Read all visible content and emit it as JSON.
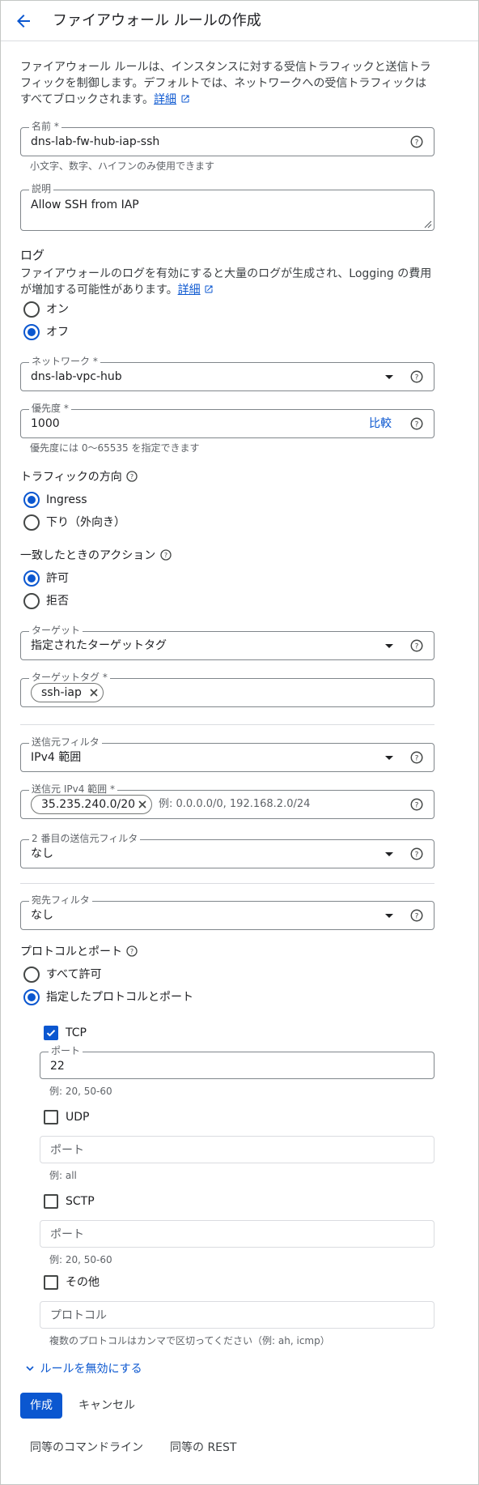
{
  "header": {
    "title": "ファイアウォール ルールの作成"
  },
  "intro": {
    "line1": "ファイアウォール ルールは、インスタンスに対する受信トラフィックと送信トラ",
    "line2": "フィックを制御します。デフォルトでは、ネットワークへの受信トラフィックは",
    "line3": "すべてブロックされます。",
    "link": "詳細"
  },
  "name_field": {
    "label": "名前 *",
    "value": "dns-lab-fw-hub-iap-ssh",
    "hint": "小文字、数字、ハイフンのみ使用できます"
  },
  "description_field": {
    "label": "説明",
    "value": "Allow SSH from IAP"
  },
  "logs": {
    "title": "ログ",
    "line1": "ファイアウォールのログを有効にすると大量のログが生成され、Logging の費用",
    "line2": "が増加する可能性があります。",
    "link": "詳細",
    "options": [
      {
        "label": "オン",
        "selected": false
      },
      {
        "label": "オフ",
        "selected": true
      }
    ]
  },
  "network_field": {
    "label": "ネットワーク *",
    "value": "dns-lab-vpc-hub"
  },
  "priority_field": {
    "label": "優先度 *",
    "value": "1000",
    "compare": "比較",
    "hint": "優先度には 0〜65535 を指定できます"
  },
  "direction": {
    "title": "トラフィックの方向",
    "options": [
      {
        "label": "Ingress",
        "selected": true
      },
      {
        "label": "下り（外向き）",
        "selected": false
      }
    ]
  },
  "action": {
    "title": "一致したときのアクション",
    "options": [
      {
        "label": "許可",
        "selected": true
      },
      {
        "label": "拒否",
        "selected": false
      }
    ]
  },
  "target_field": {
    "label": "ターゲット",
    "value": "指定されたターゲットタグ"
  },
  "target_tags_field": {
    "label": "ターゲットタグ *",
    "chip": "ssh-iap"
  },
  "source_filter_field": {
    "label": "送信元フィルタ",
    "value": "IPv4 範囲"
  },
  "source_ranges_field": {
    "label": "送信元 IPv4 範囲 *",
    "chip": "35.235.240.0/20",
    "placeholder": "例: 0.0.0.0/0, 192.168.2.0/24"
  },
  "second_source_filter_field": {
    "label": "2 番目の送信元フィルタ",
    "value": "なし"
  },
  "dest_filter_field": {
    "label": "宛先フィルタ",
    "value": "なし"
  },
  "protocols": {
    "title": "プロトコルとポート",
    "options": [
      {
        "label": "すべて許可",
        "selected": false
      },
      {
        "label": "指定したプロトコルとポート",
        "selected": true
      }
    ],
    "tcp": {
      "label": "TCP",
      "checked": true,
      "port_label": "ポート",
      "port_value": "22",
      "hint": "例: 20, 50-60"
    },
    "udp": {
      "label": "UDP",
      "checked": false,
      "placeholder": "ポート",
      "hint": "例: all"
    },
    "sctp": {
      "label": "SCTP",
      "checked": false,
      "placeholder": "ポート",
      "hint": "例: 20, 50-60"
    },
    "other": {
      "label": "その他",
      "checked": false,
      "placeholder": "プロトコル",
      "hint": "複数のプロトコルはカンマで区切ってください（例: ah, icmp）"
    }
  },
  "disable_rule": "ルールを無効にする",
  "buttons": {
    "create": "作成",
    "cancel": "キャンセル"
  },
  "footer": {
    "command_line": "同等のコマンドライン",
    "rest": "同等の REST"
  },
  "colors": {
    "accent": "#0b57d0",
    "text": "#202124",
    "muted": "#5f6368",
    "border": "#80868b"
  }
}
